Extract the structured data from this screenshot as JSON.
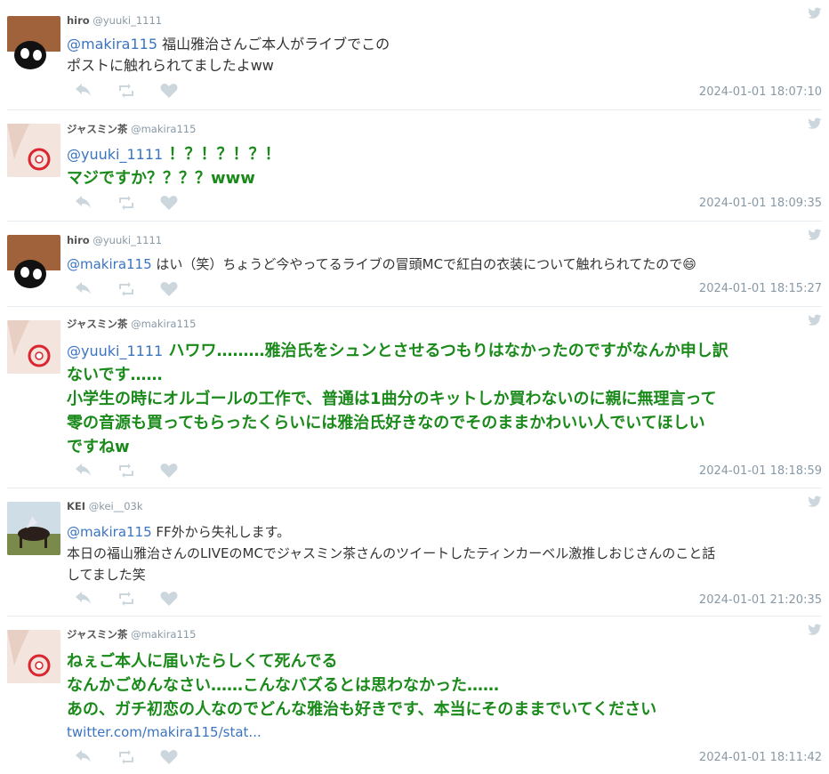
{
  "tweets": [
    {
      "name": "hiro",
      "handle": "@yuuki_1111",
      "mention": "@makira115",
      "text_line1": " 福山雅治さんご本人がライブでこの",
      "text_line2": "ポストに触れられてましたよww",
      "time": "2024-01-01 18:07:10"
    },
    {
      "name": "ジャスミン茶",
      "handle": "@makira115",
      "mention": "@yuuki_1111",
      "text_line1": " ！？！？！？！",
      "text_line2": "マジですか？？？？www",
      "time": "2024-01-01 18:09:35"
    },
    {
      "name": "hiro",
      "handle": "@yuuki_1111",
      "mention": "@makira115",
      "text_line1": " はい（笑）ちょうど今やってるライブの冒頭MCで紅白の衣装について触れられてたので😄",
      "time": "2024-01-01 18:15:27"
    },
    {
      "name": "ジャスミン茶",
      "handle": "@makira115",
      "mention": "@yuuki_1111",
      "text_line1": " ハワワ………雅治氏をシュンとさせるつもりはなかったのですがなんか申し訳",
      "text_line2": "ないです……",
      "text_line3": "小学生の時にオルゴールの工作で、普通は1曲分のキットしか買わないのに親に無理言って",
      "text_line4": "零の音源も買ってもらったくらいには雅治氏好きなのでそのままかわいい人でいてほしい",
      "text_line5": "ですねw",
      "time": "2024-01-01 18:18:59"
    },
    {
      "name": "KEI",
      "handle": "@kei__03k",
      "mention": "@makira115",
      "text_line1": " FF外から失礼します。",
      "text_line2": "本日の福山雅治さんのLIVEのMCでジャスミン茶さんのツイートしたティンカーベル激推しおじさんのこと話",
      "text_line3": "してました笑",
      "time": "2024-01-01 21:20:35"
    },
    {
      "name": "ジャスミン茶",
      "handle": "@makira115",
      "text_line1": "ねぇご本人に届いたらしくて死んでる",
      "text_line2": "なんかごめんなさい……こんなバズるとは思わなかった……",
      "text_line3": "あの、ガチ初恋の人なのでどんな雅治も好きです、本当にそのままでいてください",
      "link": "twitter.com/makira115/stat...",
      "time": "2024-01-01 18:11:42"
    }
  ],
  "colors": {
    "green": "#1a8a1a",
    "mention": "#3b74c0",
    "meta": "#8899a6"
  },
  "icons": {
    "reply": "reply-icon",
    "retweet": "retweet-icon",
    "like": "heart-icon",
    "bird": "twitter-bird-icon"
  }
}
